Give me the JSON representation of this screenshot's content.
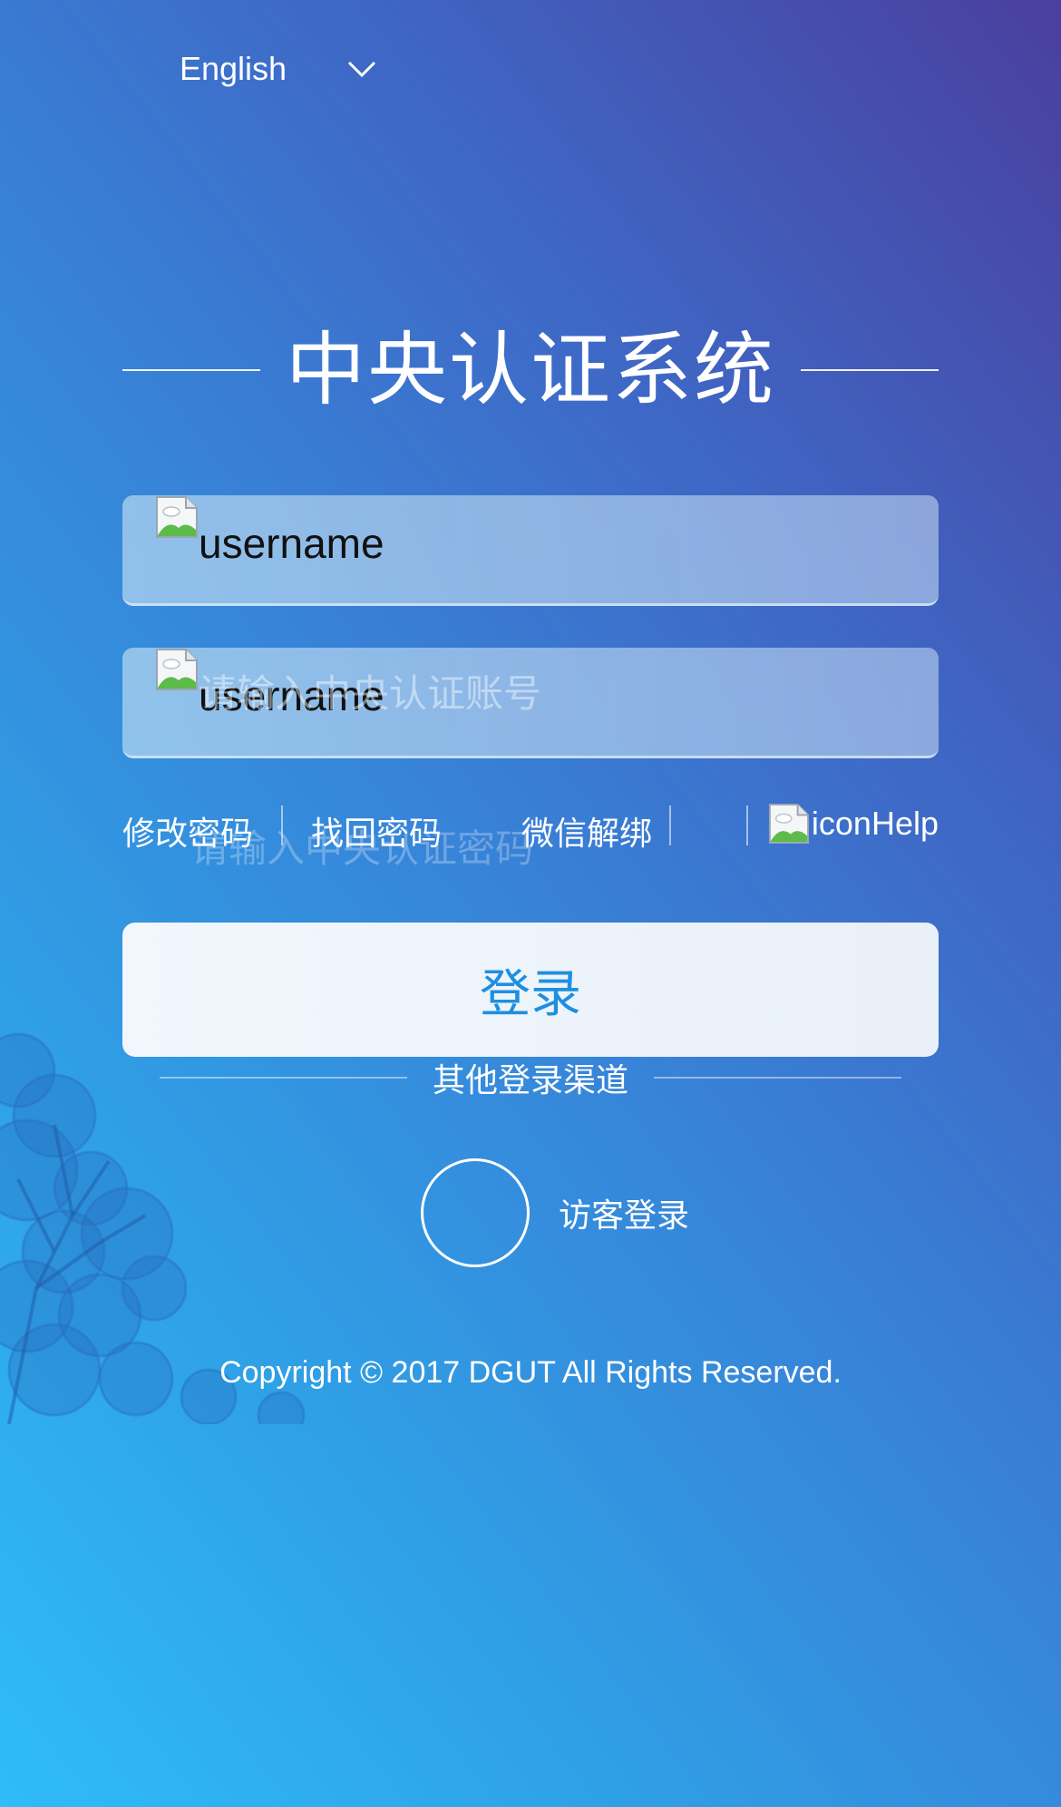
{
  "language_selector": {
    "label": "English",
    "icon": "chevron-down-icon"
  },
  "title": "中央认证系统",
  "form": {
    "username": {
      "icon_alt": "username",
      "placeholder": "请输入中央认证账号",
      "value": ""
    },
    "password": {
      "icon_alt": "username",
      "placeholder": "请输入中央认证密码",
      "value": ""
    }
  },
  "links": {
    "change_password": "修改密码",
    "recover_password": "找回密码",
    "wechat_unbind": "微信解绑",
    "help_alt": "iconHelp"
  },
  "login_button": "登录",
  "other_login": {
    "label": "其他登录渠道",
    "guest_label": "访客登录"
  },
  "footer": {
    "copyright": "Copyright © 2017 DGUT All Rights Reserved."
  },
  "colors": {
    "gradient_top_right": "#4a3f9e",
    "gradient_bottom_left": "#2fbcf8",
    "login_text": "#1e8fe0",
    "login_bg": "#f1f7fd"
  }
}
